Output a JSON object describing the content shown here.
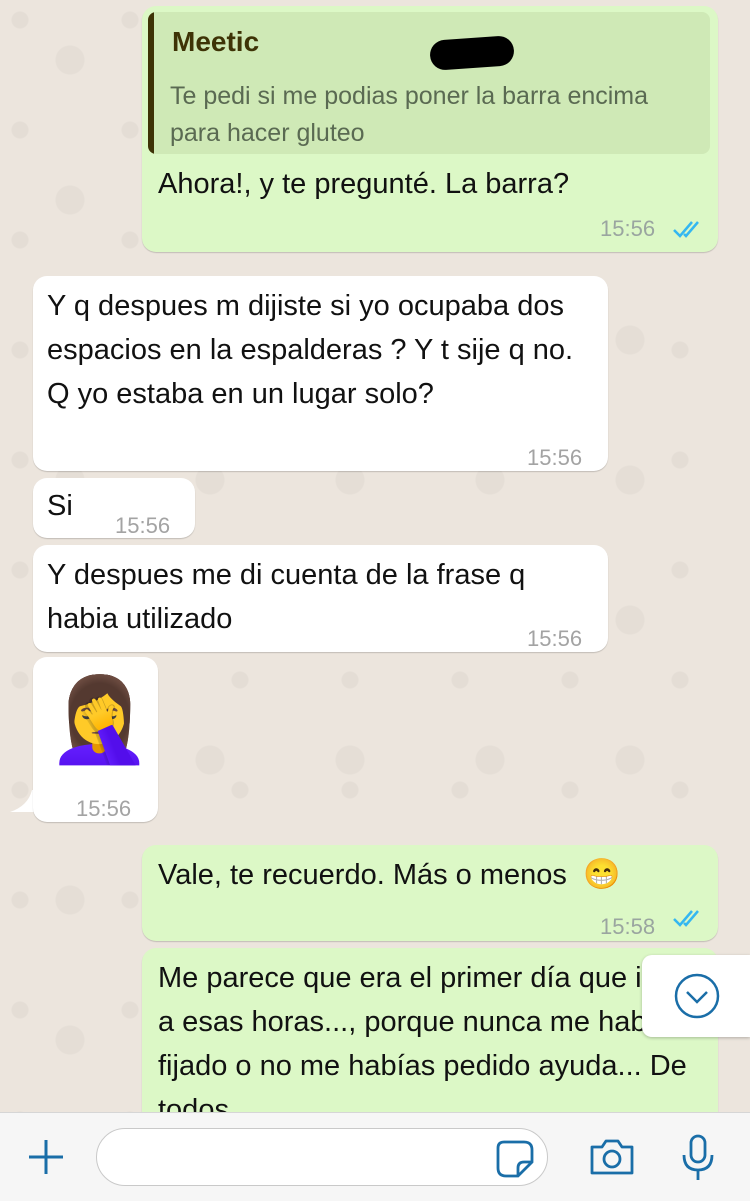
{
  "messages": {
    "m1": {
      "quote_name": "Meetic",
      "quote_text": "Te pedi si me podias poner la barra encima para hacer gluteo",
      "text": "Ahora!, y te pregunté. La barra?",
      "time": "15:56"
    },
    "m2": {
      "text": "Y q despues m dijiste si yo ocupaba dos espacios en la espalderas ? Y t sije q no. Q yo estaba en un lugar solo?",
      "time": "15:56"
    },
    "m3": {
      "text": "Si",
      "time": "15:56"
    },
    "m4": {
      "text": "Y despues me di cuenta de la frase q habia utilizado",
      "time": "15:56"
    },
    "m5": {
      "emoji": "🤦‍♀️",
      "time": "15:56"
    },
    "m6": {
      "text": "Vale, te recuerdo. Más o menos",
      "emoji": "😁",
      "time": "15:58"
    },
    "m7": {
      "text": "Me parece que era el primer día que ibas a esas horas..., porque nunca me había fijado o no me habías pedido ayuda... De todos"
    }
  },
  "input": {
    "placeholder": ""
  },
  "colors": {
    "outgoing_bubble": "#dcf8c6",
    "incoming_bubble": "#ffffff",
    "read_ticks": "#34b7f1",
    "accent_icons": "#1a6ea8"
  },
  "icons": [
    "plus-icon",
    "sticker-icon",
    "camera-icon",
    "microphone-icon",
    "chevron-down-icon",
    "double-check-icon"
  ]
}
